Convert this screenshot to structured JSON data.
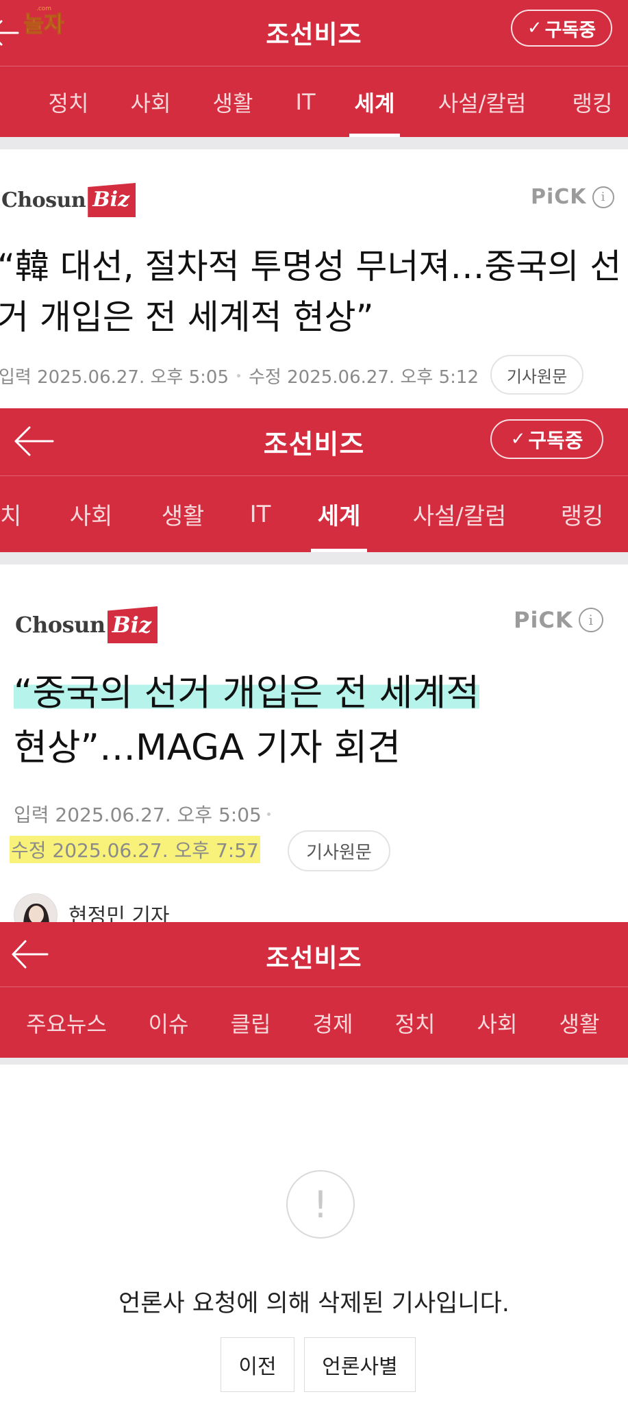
{
  "watermark": {
    "text": "놀자",
    "domain": ".com"
  },
  "panel1": {
    "header": {
      "title": "조선비즈",
      "subscribe_label": "구독중"
    },
    "nav": [
      "세계",
      "정치",
      "사회",
      "생활",
      "IT",
      "세계",
      "사설/칼럼",
      "랭킹"
    ],
    "logo": {
      "chosun": "Chosun",
      "biz": "Biz"
    },
    "pick": {
      "label": "PiCK",
      "info": "i"
    },
    "headline": "“韓 대선, 절차적 투명성 무너져…중국의 선거 개입은 전 세계적 현상”",
    "meta": {
      "input": "입력 2025.06.27. 오후 5:05",
      "modified": "수정 2025.06.27. 오후 5:12",
      "original_label": "기사원문"
    }
  },
  "panel2": {
    "header": {
      "title": "조선비즈",
      "subscribe_label": "구독중"
    },
    "nav": [
      "정치",
      "사회",
      "생활",
      "IT",
      "세계",
      "사설/칼럼",
      "랭킹"
    ],
    "logo": {
      "chosun": "Chosun",
      "biz": "Biz"
    },
    "pick": {
      "label": "PiCK",
      "info": "i"
    },
    "headline_line1": "“중국의 선거 개입은 전 세계적",
    "headline_line2": "현상”…MAGA 기자 회견",
    "meta": {
      "input": "입력 2025.06.27. 오후 5:05",
      "modified": "수정 2025.06.27. 오후 7:57",
      "original_label": "기사원문"
    },
    "reporter": "현정민 기자"
  },
  "panel3": {
    "header": {
      "title": "조선비즈"
    },
    "nav": [
      "주요뉴스",
      "이슈",
      "클립",
      "경제",
      "정치",
      "사회",
      "생활"
    ],
    "alert_symbol": "!",
    "message": "언론사 요청에 의해 삭제된 기사입니다.",
    "buttons": {
      "prev": "이전",
      "by_press": "언론사별"
    }
  },
  "colors": {
    "brand_red": "#d42d3f",
    "highlight_mint": "#b6f3ea",
    "highlight_yellow": "#f9f27a"
  }
}
